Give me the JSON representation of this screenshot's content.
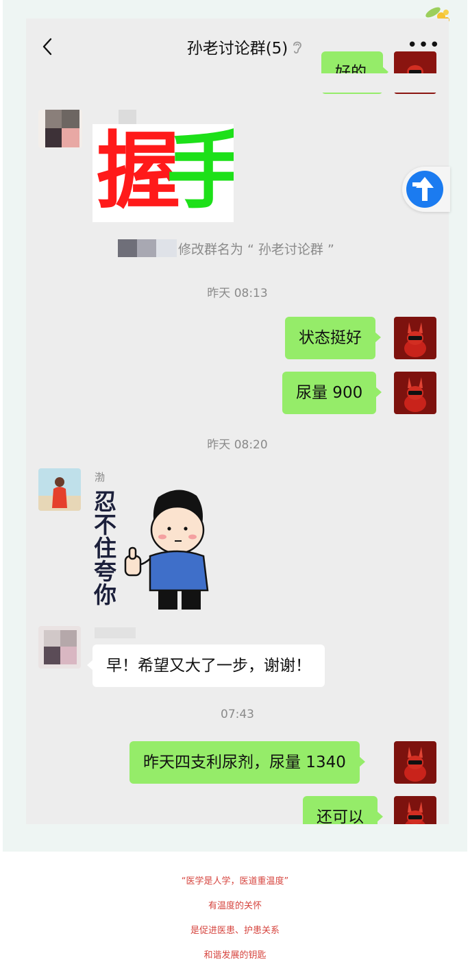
{
  "chat": {
    "title": "孙老讨论群(5)",
    "messages": {
      "top_partial": "好的",
      "sticker_text_1": "握",
      "sticker_text_2": "手",
      "system_notice": "修改群名为 “ 孙老讨论群 ”",
      "time_1": "昨天 08:13",
      "msg_status": "状态挺好",
      "msg_urine": "尿量 900",
      "time_2": "昨天 08:20",
      "nick_bo": "渤",
      "sticker_praise": "忍不住夸你",
      "msg_morning": "早！希望又大了一步，谢谢！",
      "time_3": "07:43",
      "msg_diuretic": "昨天四支利尿剂，尿量 1340",
      "msg_ok": "还可以"
    }
  },
  "footer": {
    "line1": "“医学是人学，医道重温度”",
    "line2": "有温度的关怀",
    "line3": "是促进医患、护患关系",
    "line4": "和谐发展的钥匙"
  },
  "colors": {
    "bubble_green": "#95ec69",
    "chat_bg": "#ededed",
    "accent_red": "#d6443e",
    "nav_blue": "#1b7bf0"
  }
}
